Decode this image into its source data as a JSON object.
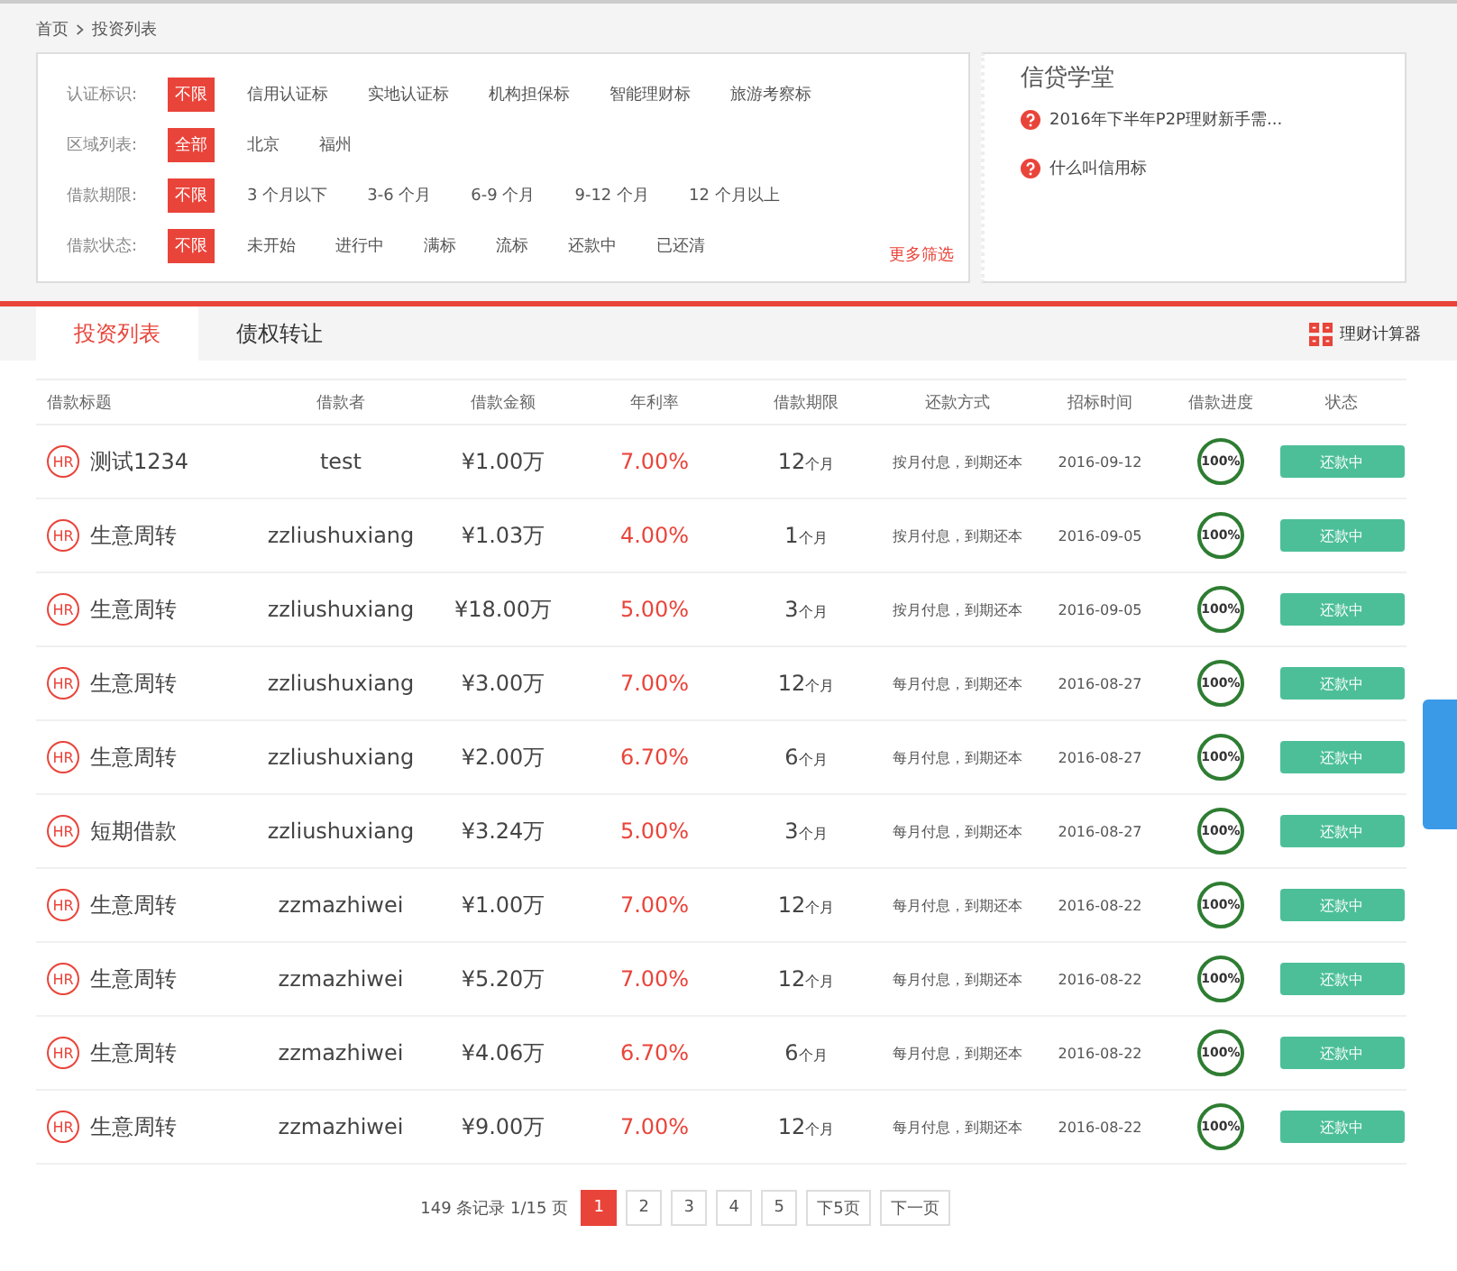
{
  "breadcrumb": [
    "首页",
    "投资列表"
  ],
  "filters": [
    {
      "label": "认证标识:",
      "options": [
        {
          "text": "不限",
          "selected": true
        },
        {
          "text": "信用认证标",
          "selected": false
        },
        {
          "text": "实地认证标",
          "selected": false
        },
        {
          "text": "机构担保标",
          "selected": false
        },
        {
          "text": "智能理财标",
          "selected": false
        },
        {
          "text": "旅游考察标",
          "selected": false
        }
      ]
    },
    {
      "label": "区域列表:",
      "options": [
        {
          "text": "全部",
          "selected": true
        },
        {
          "text": "北京",
          "selected": false
        },
        {
          "text": "福州",
          "selected": false
        }
      ]
    },
    {
      "label": "借款期限:",
      "options": [
        {
          "text": "不限",
          "selected": true
        },
        {
          "text": "3 个月以下",
          "selected": false
        },
        {
          "text": "3-6 个月",
          "selected": false
        },
        {
          "text": "6-9 个月",
          "selected": false
        },
        {
          "text": "9-12 个月",
          "selected": false
        },
        {
          "text": "12 个月以上",
          "selected": false
        }
      ]
    },
    {
      "label": "借款状态:",
      "options": [
        {
          "text": "不限",
          "selected": true
        },
        {
          "text": "未开始",
          "selected": false
        },
        {
          "text": "进行中",
          "selected": false
        },
        {
          "text": "满标",
          "selected": false
        },
        {
          "text": "流标",
          "selected": false
        },
        {
          "text": "还款中",
          "selected": false
        },
        {
          "text": "已还清",
          "selected": false
        }
      ]
    }
  ],
  "more_filters": "更多筛选",
  "academy": {
    "title": "信贷学堂",
    "links": [
      "2016年下半年P2P理财新手需...",
      "什么叫信用标"
    ]
  },
  "tabs": [
    {
      "label": "投资列表",
      "selected": true
    },
    {
      "label": "债权转让",
      "selected": false
    }
  ],
  "calculator": "理财计算器",
  "table": {
    "columns": [
      "借款标题",
      "借款者",
      "借款金额",
      "年利率",
      "借款期限",
      "还款方式",
      "招标时间",
      "借款进度",
      "状态"
    ],
    "rows": [
      {
        "tag": "HR",
        "title": "测试1234",
        "borrower": "test",
        "amount": "¥1.00万",
        "rate": "7.00%",
        "term": "12",
        "unit": "个月",
        "method": "按月付息，到期还本",
        "date": "2016-09-12",
        "progress": "100%",
        "status": "还款中"
      },
      {
        "tag": "HR",
        "title": "生意周转",
        "borrower": "zzliushuxiang",
        "amount": "¥1.03万",
        "rate": "4.00%",
        "term": "1",
        "unit": "个月",
        "method": "按月付息，到期还本",
        "date": "2016-09-05",
        "progress": "100%",
        "status": "还款中"
      },
      {
        "tag": "HR",
        "title": "生意周转",
        "borrower": "zzliushuxiang",
        "amount": "¥18.00万",
        "rate": "5.00%",
        "term": "3",
        "unit": "个月",
        "method": "按月付息，到期还本",
        "date": "2016-09-05",
        "progress": "100%",
        "status": "还款中"
      },
      {
        "tag": "HR",
        "title": "生意周转",
        "borrower": "zzliushuxiang",
        "amount": "¥3.00万",
        "rate": "7.00%",
        "term": "12",
        "unit": "个月",
        "method": "每月付息，到期还本",
        "date": "2016-08-27",
        "progress": "100%",
        "status": "还款中"
      },
      {
        "tag": "HR",
        "title": "生意周转",
        "borrower": "zzliushuxiang",
        "amount": "¥2.00万",
        "rate": "6.70%",
        "term": "6",
        "unit": "个月",
        "method": "每月付息，到期还本",
        "date": "2016-08-27",
        "progress": "100%",
        "status": "还款中"
      },
      {
        "tag": "HR",
        "title": "短期借款",
        "borrower": "zzliushuxiang",
        "amount": "¥3.24万",
        "rate": "5.00%",
        "term": "3",
        "unit": "个月",
        "method": "每月付息，到期还本",
        "date": "2016-08-27",
        "progress": "100%",
        "status": "还款中"
      },
      {
        "tag": "HR",
        "title": "生意周转",
        "borrower": "zzmazhiwei",
        "amount": "¥1.00万",
        "rate": "7.00%",
        "term": "12",
        "unit": "个月",
        "method": "每月付息，到期还本",
        "date": "2016-08-22",
        "progress": "100%",
        "status": "还款中"
      },
      {
        "tag": "HR",
        "title": "生意周转",
        "borrower": "zzmazhiwei",
        "amount": "¥5.20万",
        "rate": "7.00%",
        "term": "12",
        "unit": "个月",
        "method": "每月付息，到期还本",
        "date": "2016-08-22",
        "progress": "100%",
        "status": "还款中"
      },
      {
        "tag": "HR",
        "title": "生意周转",
        "borrower": "zzmazhiwei",
        "amount": "¥4.06万",
        "rate": "6.70%",
        "term": "6",
        "unit": "个月",
        "method": "每月付息，到期还本",
        "date": "2016-08-22",
        "progress": "100%",
        "status": "还款中"
      },
      {
        "tag": "HR",
        "title": "生意周转",
        "borrower": "zzmazhiwei",
        "amount": "¥9.00万",
        "rate": "7.00%",
        "term": "12",
        "unit": "个月",
        "method": "每月付息，到期还本",
        "date": "2016-08-22",
        "progress": "100%",
        "status": "还款中"
      }
    ]
  },
  "pagination": {
    "summary": "149 条记录 1/15 页",
    "pages": [
      {
        "label": "1",
        "selected": true
      },
      {
        "label": "2",
        "selected": false
      },
      {
        "label": "3",
        "selected": false
      },
      {
        "label": "4",
        "selected": false
      },
      {
        "label": "5",
        "selected": false
      },
      {
        "label": "下5页",
        "selected": false
      },
      {
        "label": "下一页",
        "selected": false
      }
    ]
  }
}
